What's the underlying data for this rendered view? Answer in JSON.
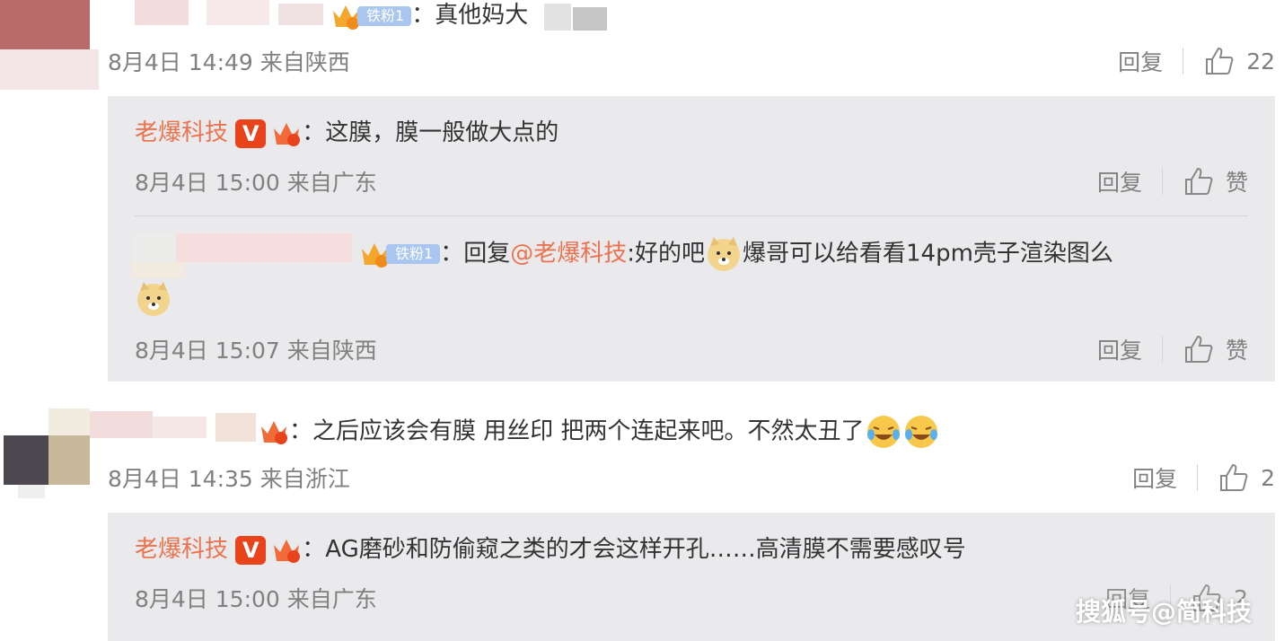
{
  "comments": [
    {
      "user_level_badge": "铁粉1",
      "text": "真他妈大",
      "meta": "8月4日 14:49 来自陕西",
      "reply_label": "回复",
      "like_count": "22"
    },
    {
      "text": "之后应该会有膜 用丝印 把两个连起来吧。不然太丑了",
      "meta": "8月4日 14:35 来自浙江",
      "reply_label": "回复",
      "like_count": "2"
    }
  ],
  "replies_1": [
    {
      "author": "老爆科技",
      "verified_badge": "V",
      "text": "这膜，膜一般做大点的",
      "meta": "8月4日 15:00 来自广东",
      "reply_label": "回复",
      "like_label": "赞"
    },
    {
      "user_level_badge": "铁粉1",
      "reply_prefix": "回复",
      "mention": "@老爆科技",
      "text_a": ":好的吧",
      "text_b": "爆哥可以给看看14pm壳子渲染图么",
      "meta": "8月4日 15:07 来自陕西",
      "reply_label": "回复",
      "like_label": "赞"
    }
  ],
  "replies_2": [
    {
      "author": "老爆科技",
      "verified_badge": "V",
      "text": "AG磨砂和防偷窥之类的才会这样开孔……高清膜不需要感叹号",
      "meta": "8月4日 15:00 来自广东",
      "reply_label": "回复",
      "like_count": "2"
    }
  ],
  "colon": "：",
  "watermark": "搜狐号@简科技",
  "colors": {
    "link": "#eb7350",
    "meta": "#808080",
    "reply_bg": "#eaeaec",
    "verified": "#e8431b",
    "fan_badge": "#a9c6f0"
  },
  "icons": [
    "thumb-up-icon",
    "crown-icon",
    "doge-emoji",
    "laugh-cry-emoji"
  ]
}
